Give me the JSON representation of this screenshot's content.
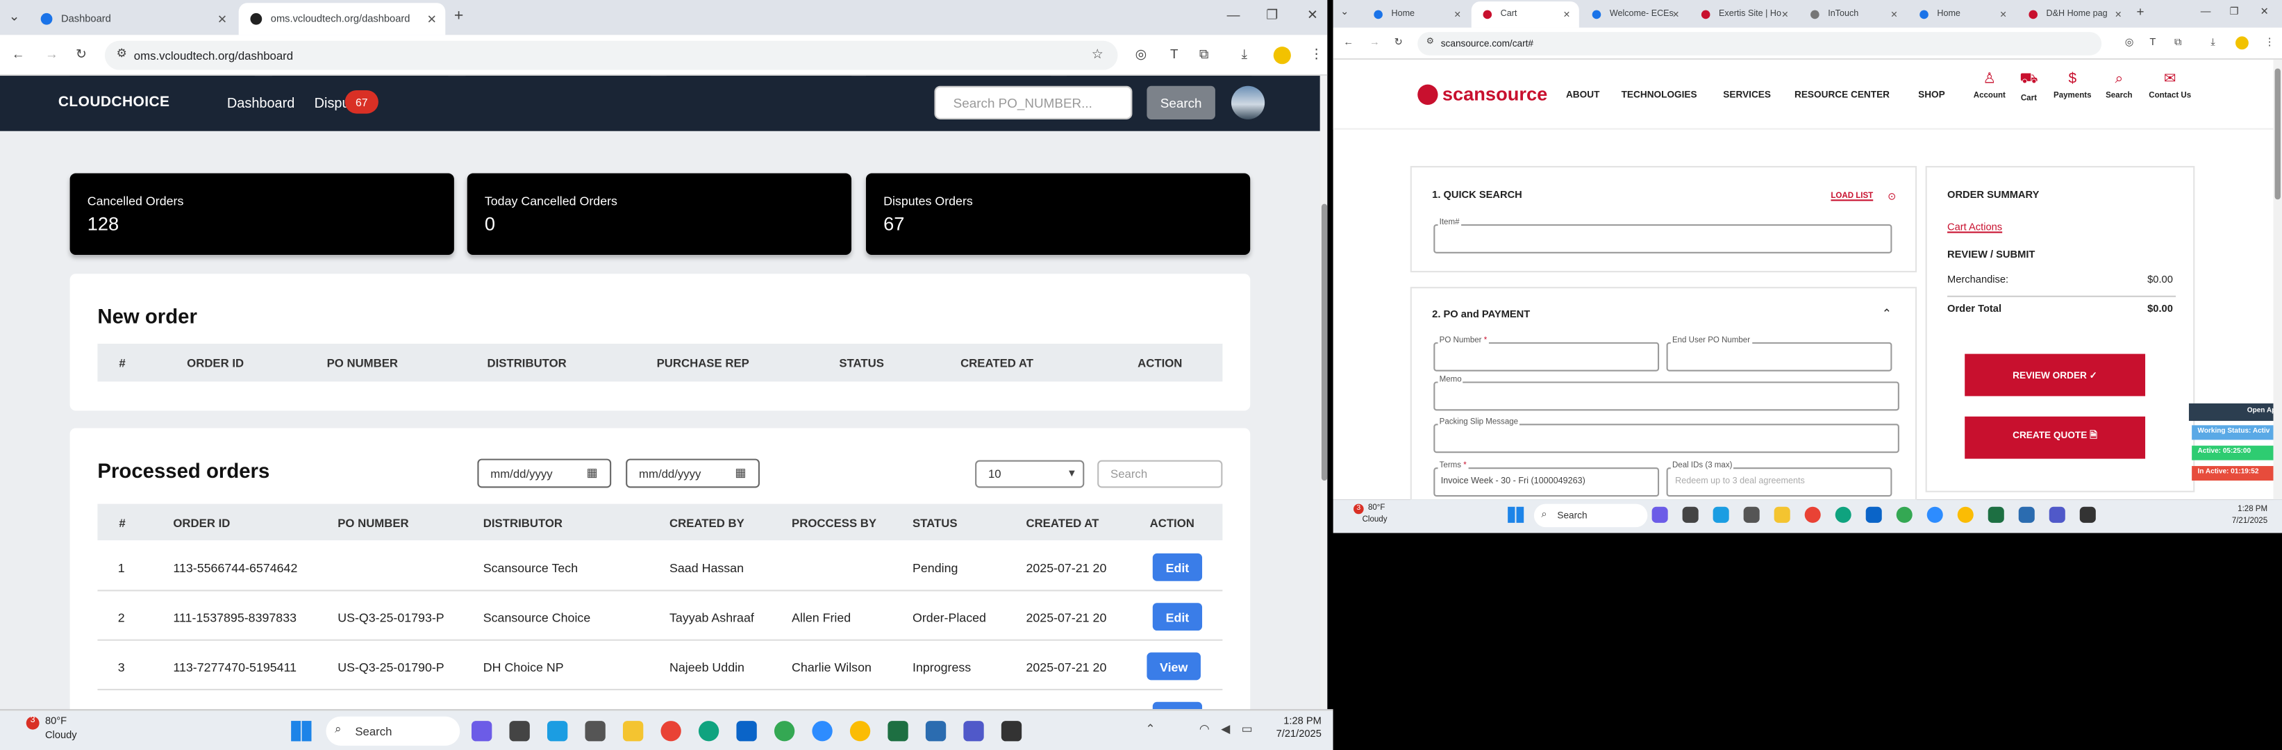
{
  "left": {
    "tabs": [
      {
        "label": "Dashboard"
      },
      {
        "label": "oms.vcloudtech.org/dashboard"
      }
    ],
    "url": "oms.vcloudtech.org/dashboard",
    "brand": "CLOUDCHOICE",
    "nav": {
      "dashboard": "Dashboard",
      "disputes": "Dispu",
      "disputes_badge": "67"
    },
    "search": {
      "placeholder": "Search PO_NUMBER...",
      "button": "Search"
    },
    "cards": [
      {
        "title": "Cancelled Orders",
        "value": "128"
      },
      {
        "title": "Today Cancelled Orders",
        "value": "0"
      },
      {
        "title": "Disputes Orders",
        "value": "67"
      }
    ],
    "new_order": {
      "title": "New order",
      "headers": [
        "#",
        "ORDER ID",
        "PO NUMBER",
        "DISTRIBUTOR",
        "PURCHASE REP",
        "STATUS",
        "CREATED AT",
        "ACTION"
      ]
    },
    "processed": {
      "title": "Processed orders",
      "date_from": "mm/dd/yyyy",
      "date_to": "mm/dd/yyyy",
      "page_size": "10",
      "search_placeholder": "Search",
      "headers": [
        "#",
        "ORDER ID",
        "PO NUMBER",
        "DISTRIBUTOR",
        "CREATED BY",
        "PROCCESS BY",
        "STATUS",
        "CREATED AT",
        "ACTION"
      ],
      "rows": [
        {
          "n": "1",
          "order_id": "113-5566744-6574642",
          "po": "",
          "distributor": "Scansource Tech",
          "created_by": "Saad Hassan",
          "process_by": "",
          "status": "Pending",
          "created_at": "2025-07-21 20",
          "action": "Edit"
        },
        {
          "n": "2",
          "order_id": "111-1537895-8397833",
          "po": "US-Q3-25-01793-P",
          "distributor": "Scansource Choice",
          "created_by": "Tayyab Ashraaf",
          "process_by": "Allen Fried",
          "status": "Order-Placed",
          "created_at": "2025-07-21 20",
          "action": "Edit"
        },
        {
          "n": "3",
          "order_id": "113-7277470-5195411",
          "po": "US-Q3-25-01790-P",
          "distributor": "DH Choice NP",
          "created_by": "Najeeb Uddin",
          "process_by": "Charlie Wilson",
          "status": "Inprogress",
          "created_at": "2025-07-21 20",
          "action": "View"
        }
      ]
    },
    "taskbar": {
      "weather_temp": "80°F",
      "weather_desc": "Cloudy",
      "weather_badge": "3",
      "search": "Search",
      "time": "1:28 PM",
      "date": "7/21/2025"
    }
  },
  "right": {
    "tabs": [
      {
        "label": "Home"
      },
      {
        "label": "Cart"
      },
      {
        "label": "Welcome- ECEs"
      },
      {
        "label": "Exertis Site | Ho"
      },
      {
        "label": "InTouch"
      },
      {
        "label": "Home"
      },
      {
        "label": "D&H Home pag"
      }
    ],
    "url": "scansource.com/cart#",
    "brand": "scansource",
    "menu": [
      "ABOUT",
      "TECHNOLOGIES",
      "SERVICES",
      "RESOURCE CENTER",
      "SHOP"
    ],
    "icons": [
      {
        "label": "Account"
      },
      {
        "label": "Cart"
      },
      {
        "label": "Payments"
      },
      {
        "label": "Search"
      },
      {
        "label": "Contact Us"
      }
    ],
    "quick_search": {
      "title": "1. QUICK SEARCH",
      "load_list": "LOAD LIST",
      "item_label": "Item#"
    },
    "po_payment": {
      "title": "2. PO and PAYMENT",
      "po_number": "PO Number",
      "end_user_po": "End User PO Number",
      "memo": "Memo",
      "packing_slip": "Packing Slip Message",
      "terms_label": "Terms",
      "terms_value": "Invoice Week - 30 - Fri (1000049263)",
      "deal_label": "Deal IDs (3 max)",
      "deal_placeholder": "Redeem up to 3 deal agreements"
    },
    "summary": {
      "title": "ORDER SUMMARY",
      "cart_actions": "Cart Actions",
      "review_title": "REVIEW / SUBMIT",
      "merch_label": "Merchandise:",
      "merch_value": "$0.00",
      "total_label": "Order Total",
      "total_value": "$0.00",
      "review_btn": "REVIEW ORDER ✓",
      "quote_btn": "CREATE QUOTE 🗎"
    },
    "status_widget": {
      "open": "Open Ap",
      "working": "Working Status: Activ",
      "active": "Active: 05:25:00",
      "inactive": "In Active: 01:19:52"
    },
    "taskbar": {
      "weather_temp": "80°F",
      "weather_desc": "Cloudy",
      "weather_badge": "3",
      "search": "Search",
      "time": "1:28 PM",
      "date": "7/21/2025"
    }
  },
  "colors": {
    "nav_bg": "#1a2535",
    "badge": "#d93025",
    "btn_blue": "#3a7de8",
    "ss_red": "#c8102e"
  }
}
